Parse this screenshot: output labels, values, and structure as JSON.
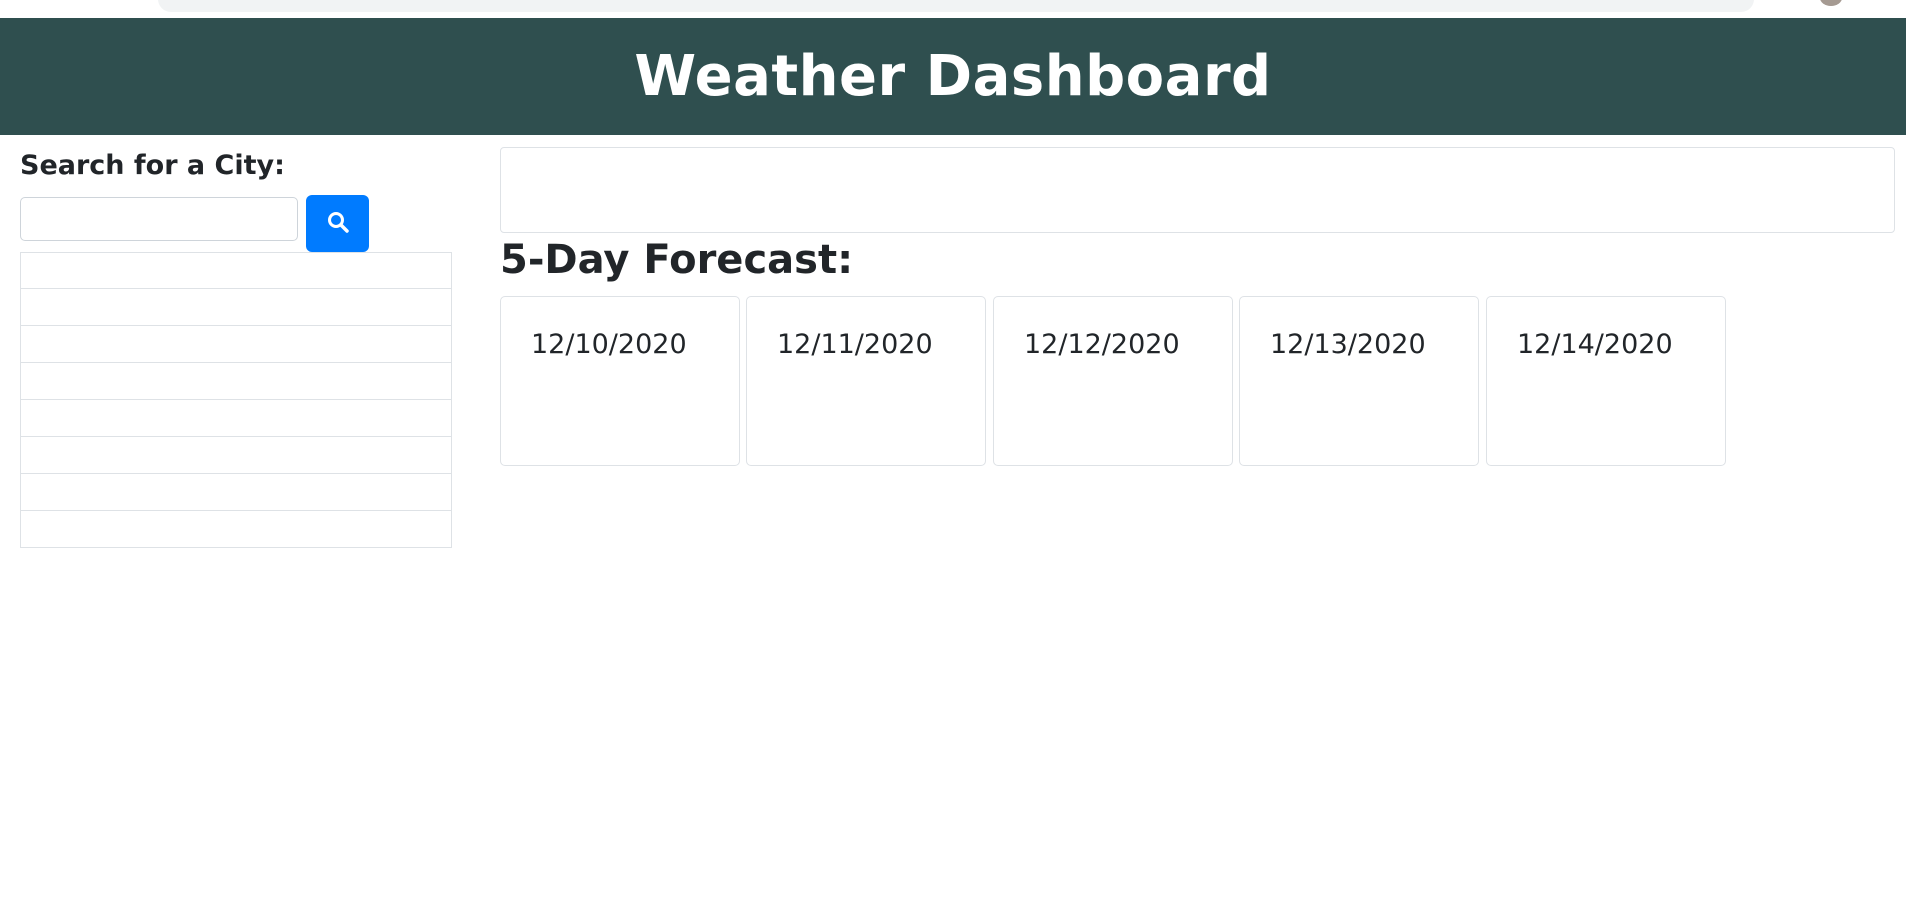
{
  "header": {
    "title": "Weather Dashboard"
  },
  "sidebar": {
    "search_label": "Search for a City:",
    "search_input_value": "",
    "search_icon": "search-icon",
    "city_history": [
      "",
      "",
      "",
      "",
      "",
      "",
      "",
      ""
    ]
  },
  "forecast": {
    "title": "5-Day Forecast:",
    "days": [
      {
        "date": "12/10/2020"
      },
      {
        "date": "12/11/2020"
      },
      {
        "date": "12/12/2020"
      },
      {
        "date": "12/13/2020"
      },
      {
        "date": "12/14/2020"
      }
    ]
  },
  "colors": {
    "header_bg": "#2f4f4f",
    "button_bg": "#007bff"
  }
}
